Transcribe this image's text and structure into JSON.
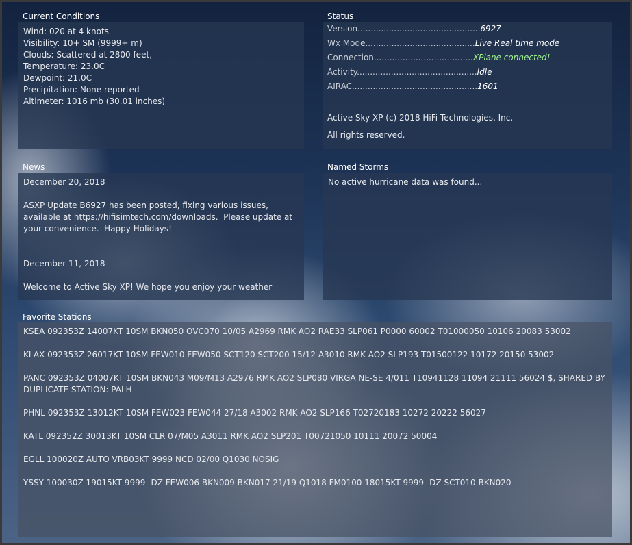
{
  "sections": {
    "current_conditions": "Current Conditions",
    "status": "Status",
    "news": "News",
    "named_storms": "Named Storms",
    "favorite_stations": "Favorite Stations"
  },
  "current_conditions": {
    "wind": "Wind: 020 at 4 knots",
    "visibility": "Visibility: 10+ SM (9999+ m)",
    "clouds": "Clouds: Scattered at 2800 feet,",
    "temperature": "Temperature: 23.0C",
    "dewpoint": "Dewpoint: 21.0C",
    "precipitation": "Precipitation: None reported",
    "altimeter": "Altimeter: 1016 mb (30.01 inches)"
  },
  "status": {
    "rows": [
      {
        "key": "Version...............................................",
        "value": "6927"
      },
      {
        "key": "Wx Mode..........................................",
        "value": "Live Real time mode"
      },
      {
        "key": "Connection......................................",
        "value": "XPlane connected!"
      },
      {
        "key": "Activity..............................................",
        "value": "Idle"
      },
      {
        "key": "AIRAC................................................",
        "value": "1601"
      }
    ],
    "copyright": "Active Sky XP (c) 2018 HiFi Technologies, Inc.",
    "rights": "All rights reserved.",
    "connected_color": "#9ff28f"
  },
  "news": {
    "item1_date": "December 20, 2018",
    "item1_text": "ASXP Update B6927 has been posted, fixing various issues, available at https://hifisimtech.com/downloads.  Please update at your convenience.  Happy Holidays!",
    "item2_date": "December 11, 2018",
    "item2_text": "Welcome to Active Sky XP!  We hope you enjoy your weather"
  },
  "named_storms": {
    "message": "No active hurricane data was found..."
  },
  "favorite_stations": [
    "KSEA 092353Z 14007KT 10SM BKN050 OVC070 10/05 A2969 RMK AO2 RAE33 SLP061 P0000 60002 T01000050 10106 20083 53002",
    "KLAX 092353Z 26017KT 10SM FEW010 FEW050 SCT120 SCT200 15/12 A3010 RMK AO2 SLP193 T01500122 10172 20150 53002",
    "PANC 092353Z 04007KT 10SM BKN043 M09/M13 A2976 RMK AO2 SLP080 VIRGA NE-SE 4/011 T10941128 11094 21111 56024 $, SHARED BY DUPLICATE STATION: PALH",
    "PHNL 092353Z 13012KT 10SM FEW023 FEW044 27/18 A3002 RMK AO2 SLP166 T02720183 10272 20222 56027",
    "KATL 092352Z 30013KT 10SM CLR 07/M05 A3011 RMK AO2 SLP201 T00721050 10111 20072 50004",
    "EGLL 100020Z AUTO VRB03KT 9999 NCD 02/00 Q1030 NOSIG",
    "YSSY 100030Z 19015KT 9999 -DZ FEW006 BKN009 BKN017 21/19 Q1018 FM0100 18015KT 9999 -DZ SCT010 BKN020"
  ]
}
